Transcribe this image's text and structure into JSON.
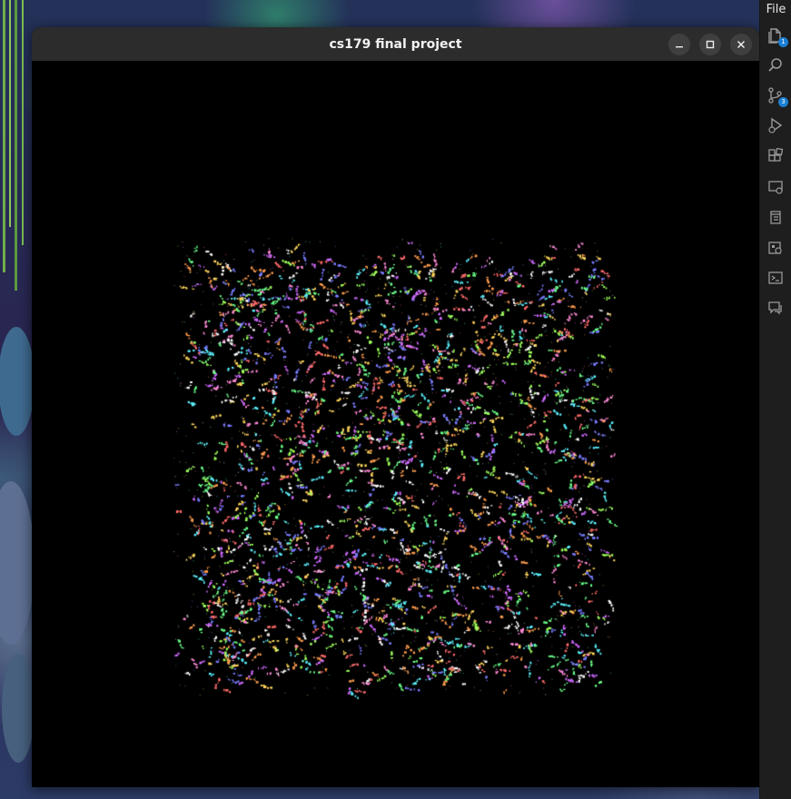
{
  "window": {
    "title": "cs179 final project"
  },
  "menu": {
    "file_label": "File"
  },
  "activity_bar": {
    "items": [
      {
        "name": "explorer-icon",
        "badge": "1"
      },
      {
        "name": "search-icon"
      },
      {
        "name": "source-control-icon",
        "badge": "3"
      },
      {
        "name": "run-debug-icon"
      },
      {
        "name": "extensions-icon"
      },
      {
        "name": "remote-explorer-icon"
      },
      {
        "name": "testing-icon"
      },
      {
        "name": "docker-icon"
      },
      {
        "name": "terminal-icon"
      },
      {
        "name": "chat-icon"
      }
    ]
  },
  "colors": {
    "title_bar": "#2c2c2c",
    "canvas_bg": "#000000",
    "badge": "#1a7fd4",
    "particle_palette": [
      "#ff6b6b",
      "#ffd65c",
      "#6bff8a",
      "#5cf2ff",
      "#7a7dff",
      "#d06bff",
      "#ff8ad6",
      "#ffffff",
      "#ff9d4d",
      "#9dff5c"
    ]
  }
}
